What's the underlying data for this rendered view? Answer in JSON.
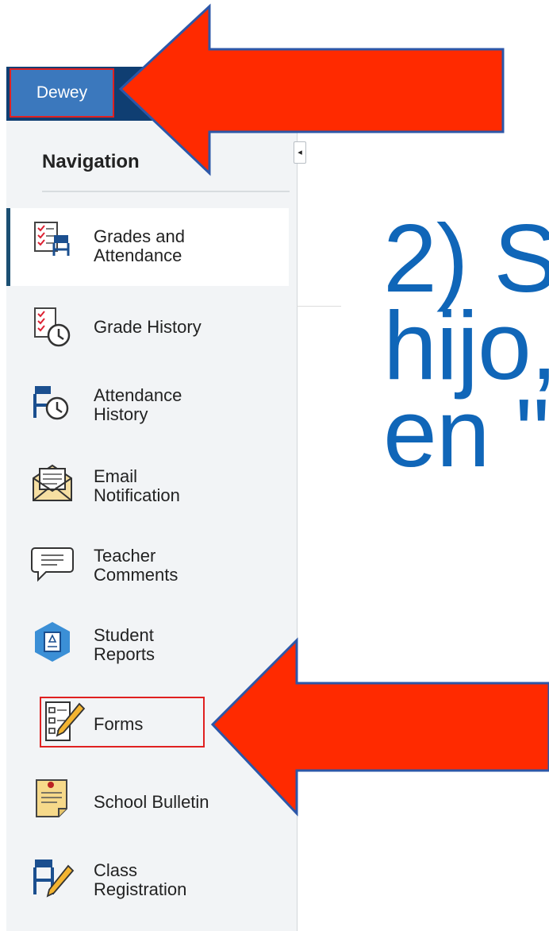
{
  "header": {
    "student_name": "Dewey"
  },
  "sidebar": {
    "heading": "Navigation",
    "items": [
      {
        "line1": "Grades and",
        "line2": "Attendance",
        "icon": "grades-attendance-icon",
        "active": true
      },
      {
        "line1": "Grade History",
        "line2": "",
        "icon": "grade-history-icon"
      },
      {
        "line1": "Attendance",
        "line2": "History",
        "icon": "attendance-history-icon"
      },
      {
        "line1": "Email",
        "line2": "Notification",
        "icon": "email-notification-icon"
      },
      {
        "line1": "Teacher",
        "line2": "Comments",
        "icon": "teacher-comments-icon"
      },
      {
        "line1": "Student",
        "line2": "Reports",
        "icon": "student-reports-icon"
      },
      {
        "line1": "Forms",
        "line2": "",
        "icon": "forms-icon",
        "highlighted": true
      },
      {
        "line1": "School Bulletin",
        "line2": "",
        "icon": "school-bulletin-icon"
      },
      {
        "line1": "Class",
        "line2": "Registration",
        "icon": "class-registration-icon"
      }
    ]
  },
  "slide": {
    "line1": "2) S",
    "line2": "hijo,",
    "line3": "en \"",
    "text_color": "#1066b8"
  },
  "annotations": {
    "arrow_color": "#ff2a00",
    "highlight_color": "#e02020"
  }
}
